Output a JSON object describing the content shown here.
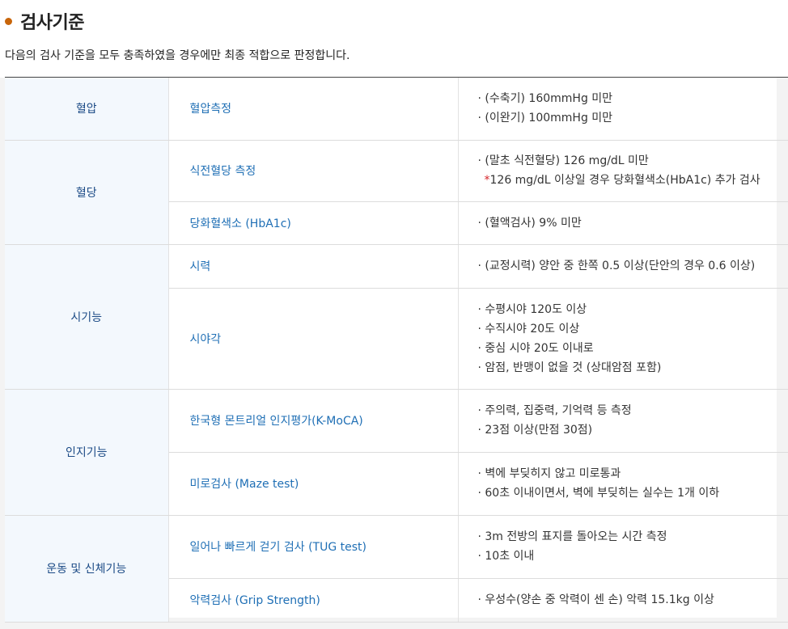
{
  "section": {
    "title": "검사기준",
    "description": "다음의 검사 기준을 모두 충족하였을 경우에만 최종 적합으로 판정합니다."
  },
  "rows": [
    {
      "category": "혈압",
      "item": "혈압측정",
      "details": [
        "· (수축기) 160mmHg 미만",
        "· (이완기) 100mmHg 미만"
      ]
    },
    {
      "category": "혈당",
      "item": "식전혈당 측정",
      "details": [
        "· (말초 식전혈당) 126 mg/dL 미만"
      ],
      "note_star": "*",
      "note": "126 mg/dL 이상일 경우 당화혈색소(HbA1c) 추가 검사"
    },
    {
      "item": "당화혈색소 (HbA1c)",
      "details": [
        "· (혈액검사) 9% 미만"
      ]
    },
    {
      "category": "시기능",
      "item": "시력",
      "details": [
        "· (교정시력) 양안 중 한쪽 0.5 이상(단안의 경우 0.6 이상)"
      ]
    },
    {
      "item": "시야각",
      "details": [
        "· 수평시야 120도 이상",
        "· 수직시야 20도 이상",
        "· 중심 시야 20도 이내로",
        "· 암점, 반맹이 없을 것 (상대암점 포함)"
      ]
    },
    {
      "category": "인지기능",
      "item": "한국형 몬트리얼 인지평가(K-MoCA)",
      "details": [
        "· 주의력, 집중력, 기억력 등 측정",
        "· 23점 이상(만점 30점)"
      ]
    },
    {
      "item": "미로검사 (Maze test)",
      "details": [
        "· 벽에 부딪히지 않고 미로통과",
        "· 60초 이내이면서, 벽에 부딪히는 실수는 1개 이하"
      ]
    },
    {
      "category": "운동 및 신체기능",
      "item": "일어나 빠르게 걷기 검사 (TUG test)",
      "details": [
        "· 3m 전방의 표지를 돌아오는 시간 측정",
        "· 10초 이내"
      ]
    },
    {
      "item": "악력검사 (Grip Strength)",
      "details": [
        "· 우성수(양손 중 악력이 센 손) 악력 15.1kg 이상"
      ]
    }
  ]
}
